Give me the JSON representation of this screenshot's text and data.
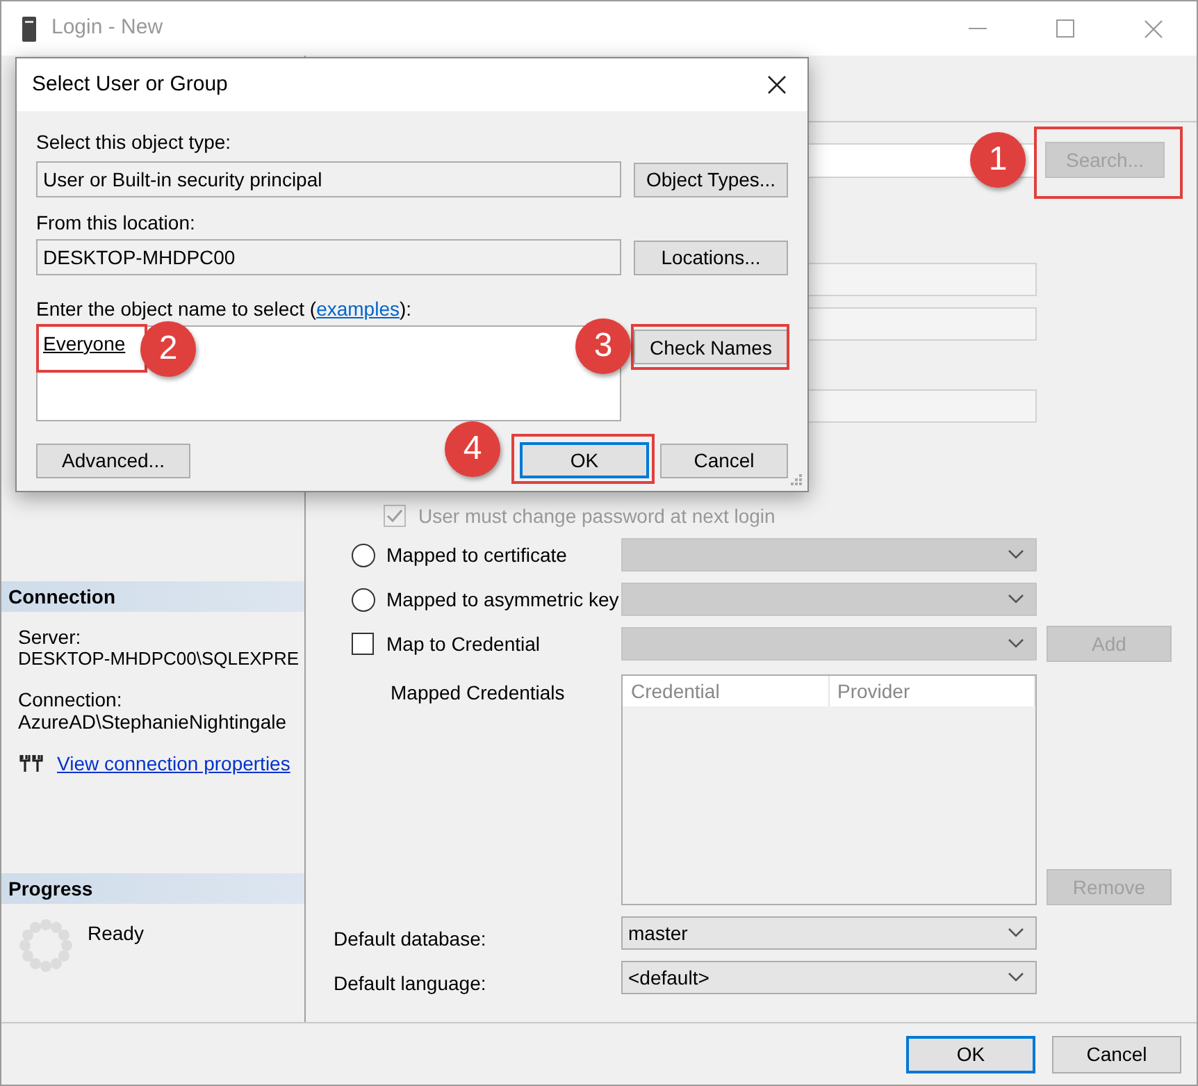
{
  "window": {
    "title": "Login - New"
  },
  "search_button": {
    "label": "Search...",
    "disabled": true
  },
  "options": [
    {
      "kind": "checkbox",
      "label": "User must change password at next login",
      "checked": true,
      "disabled": true
    },
    {
      "kind": "radio",
      "label": "Mapped to certificate",
      "selected": false
    },
    {
      "kind": "radio",
      "label": "Mapped to asymmetric key",
      "selected": false
    },
    {
      "kind": "checkbox",
      "label": "Map to Credential",
      "checked": false,
      "disabled": false
    }
  ],
  "add_button": {
    "label": "Add",
    "disabled": true
  },
  "mapped_credentials": {
    "label": "Mapped Credentials",
    "columns": [
      "Credential",
      "Provider"
    ]
  },
  "remove_button": {
    "label": "Remove",
    "disabled": true
  },
  "defaults": [
    {
      "label": "Default database:",
      "value": "master"
    },
    {
      "label": "Default language:",
      "value": "<default>"
    }
  ],
  "footer_buttons": [
    {
      "label": "OK",
      "default": true
    },
    {
      "label": "Cancel",
      "default": false
    }
  ],
  "sidebar": {
    "connection": {
      "title": "Connection",
      "server_label": "Server:",
      "server": "DESKTOP-MHDPC00\\SQLEXPRE",
      "connection_label": "Connection:",
      "connection": "AzureAD\\StephanieNightingale",
      "link": "View connection properties"
    },
    "progress": {
      "title": "Progress",
      "status": "Ready"
    }
  },
  "dialog": {
    "title": "Select User or Group",
    "object_type_label": "Select this object type:",
    "object_type": "User or Built-in security principal",
    "object_types_button": "Object Types...",
    "location_label": "From this location:",
    "location": "DESKTOP-MHDPC00",
    "locations_button": "Locations...",
    "name_label_start": "Enter the object name to select (",
    "name_label_link": "examples",
    "name_label_end": "):",
    "name_value": "Everyone",
    "check_names_button": "Check Names",
    "advanced_button": "Advanced...",
    "ok_button": "OK",
    "cancel_button": "Cancel"
  },
  "callouts": {
    "search": "1",
    "name": "2",
    "check_names": "3",
    "ok": "4"
  }
}
